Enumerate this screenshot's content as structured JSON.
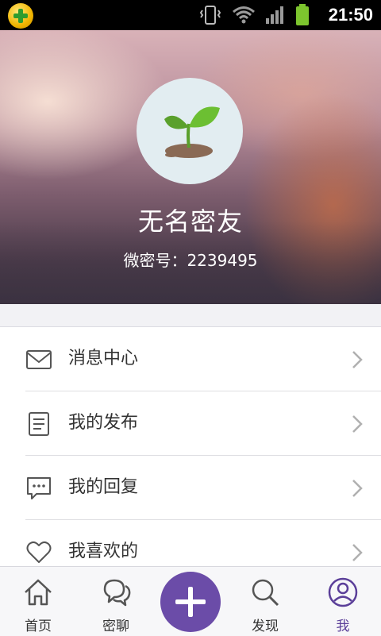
{
  "status_bar": {
    "time": "21:50",
    "icons": [
      "app-icon",
      "vibrate-icon",
      "wifi-icon",
      "signal-icon",
      "battery-icon"
    ]
  },
  "profile": {
    "username": "无名密友",
    "user_id": "微密号：2239495",
    "avatar": "sprout-icon"
  },
  "menu": {
    "items": [
      {
        "label": "消息中心",
        "icon": "mail-icon"
      },
      {
        "label": "我的发布",
        "icon": "document-icon"
      },
      {
        "label": "我的回复",
        "icon": "comment-icon"
      },
      {
        "label": "我喜欢的",
        "icon": "heart-icon"
      }
    ]
  },
  "tab_bar": {
    "tabs": [
      {
        "label": "首页",
        "icon": "home-icon"
      },
      {
        "label": "密聊",
        "icon": "chat-icon"
      },
      {
        "label": "发现",
        "icon": "search-icon"
      },
      {
        "label": "我",
        "icon": "user-icon",
        "active": true
      }
    ],
    "fab_icon": "plus-icon"
  },
  "colors": {
    "accent": "#6b4ca8",
    "status_bar": "#000000",
    "menu_text": "#333333"
  }
}
